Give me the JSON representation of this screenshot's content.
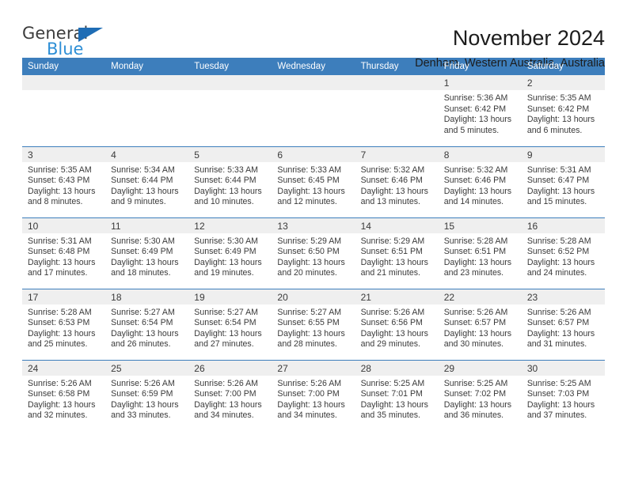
{
  "logo": {
    "primary_text": "General",
    "secondary_text": "Blue",
    "primary_color": "#3c3c3c",
    "secondary_color": "#2e8fd6",
    "triangle_color": "#1f6db5"
  },
  "header": {
    "title": "November 2024",
    "location": "Denham, Western Australia, Australia"
  },
  "theme": {
    "header_bg": "#3d7ebc",
    "header_text": "#ffffff",
    "daynum_band_bg": "#efefef",
    "cell_bg": "#ffffff",
    "row_border": "#3d7ebc",
    "body_text": "#3a3a3a"
  },
  "calendar": {
    "weekday_headers": [
      "Sunday",
      "Monday",
      "Tuesday",
      "Wednesday",
      "Thursday",
      "Friday",
      "Saturday"
    ],
    "weeks": [
      [
        {
          "day": "",
          "empty": true
        },
        {
          "day": "",
          "empty": true
        },
        {
          "day": "",
          "empty": true
        },
        {
          "day": "",
          "empty": true
        },
        {
          "day": "",
          "empty": true
        },
        {
          "day": "1",
          "sunrise": "Sunrise: 5:36 AM",
          "sunset": "Sunset: 6:42 PM",
          "daylight": "Daylight: 13 hours and 5 minutes."
        },
        {
          "day": "2",
          "sunrise": "Sunrise: 5:35 AM",
          "sunset": "Sunset: 6:42 PM",
          "daylight": "Daylight: 13 hours and 6 minutes."
        }
      ],
      [
        {
          "day": "3",
          "sunrise": "Sunrise: 5:35 AM",
          "sunset": "Sunset: 6:43 PM",
          "daylight": "Daylight: 13 hours and 8 minutes."
        },
        {
          "day": "4",
          "sunrise": "Sunrise: 5:34 AM",
          "sunset": "Sunset: 6:44 PM",
          "daylight": "Daylight: 13 hours and 9 minutes."
        },
        {
          "day": "5",
          "sunrise": "Sunrise: 5:33 AM",
          "sunset": "Sunset: 6:44 PM",
          "daylight": "Daylight: 13 hours and 10 minutes."
        },
        {
          "day": "6",
          "sunrise": "Sunrise: 5:33 AM",
          "sunset": "Sunset: 6:45 PM",
          "daylight": "Daylight: 13 hours and 12 minutes."
        },
        {
          "day": "7",
          "sunrise": "Sunrise: 5:32 AM",
          "sunset": "Sunset: 6:46 PM",
          "daylight": "Daylight: 13 hours and 13 minutes."
        },
        {
          "day": "8",
          "sunrise": "Sunrise: 5:32 AM",
          "sunset": "Sunset: 6:46 PM",
          "daylight": "Daylight: 13 hours and 14 minutes."
        },
        {
          "day": "9",
          "sunrise": "Sunrise: 5:31 AM",
          "sunset": "Sunset: 6:47 PM",
          "daylight": "Daylight: 13 hours and 15 minutes."
        }
      ],
      [
        {
          "day": "10",
          "sunrise": "Sunrise: 5:31 AM",
          "sunset": "Sunset: 6:48 PM",
          "daylight": "Daylight: 13 hours and 17 minutes."
        },
        {
          "day": "11",
          "sunrise": "Sunrise: 5:30 AM",
          "sunset": "Sunset: 6:49 PM",
          "daylight": "Daylight: 13 hours and 18 minutes."
        },
        {
          "day": "12",
          "sunrise": "Sunrise: 5:30 AM",
          "sunset": "Sunset: 6:49 PM",
          "daylight": "Daylight: 13 hours and 19 minutes."
        },
        {
          "day": "13",
          "sunrise": "Sunrise: 5:29 AM",
          "sunset": "Sunset: 6:50 PM",
          "daylight": "Daylight: 13 hours and 20 minutes."
        },
        {
          "day": "14",
          "sunrise": "Sunrise: 5:29 AM",
          "sunset": "Sunset: 6:51 PM",
          "daylight": "Daylight: 13 hours and 21 minutes."
        },
        {
          "day": "15",
          "sunrise": "Sunrise: 5:28 AM",
          "sunset": "Sunset: 6:51 PM",
          "daylight": "Daylight: 13 hours and 23 minutes."
        },
        {
          "day": "16",
          "sunrise": "Sunrise: 5:28 AM",
          "sunset": "Sunset: 6:52 PM",
          "daylight": "Daylight: 13 hours and 24 minutes."
        }
      ],
      [
        {
          "day": "17",
          "sunrise": "Sunrise: 5:28 AM",
          "sunset": "Sunset: 6:53 PM",
          "daylight": "Daylight: 13 hours and 25 minutes."
        },
        {
          "day": "18",
          "sunrise": "Sunrise: 5:27 AM",
          "sunset": "Sunset: 6:54 PM",
          "daylight": "Daylight: 13 hours and 26 minutes."
        },
        {
          "day": "19",
          "sunrise": "Sunrise: 5:27 AM",
          "sunset": "Sunset: 6:54 PM",
          "daylight": "Daylight: 13 hours and 27 minutes."
        },
        {
          "day": "20",
          "sunrise": "Sunrise: 5:27 AM",
          "sunset": "Sunset: 6:55 PM",
          "daylight": "Daylight: 13 hours and 28 minutes."
        },
        {
          "day": "21",
          "sunrise": "Sunrise: 5:26 AM",
          "sunset": "Sunset: 6:56 PM",
          "daylight": "Daylight: 13 hours and 29 minutes."
        },
        {
          "day": "22",
          "sunrise": "Sunrise: 5:26 AM",
          "sunset": "Sunset: 6:57 PM",
          "daylight": "Daylight: 13 hours and 30 minutes."
        },
        {
          "day": "23",
          "sunrise": "Sunrise: 5:26 AM",
          "sunset": "Sunset: 6:57 PM",
          "daylight": "Daylight: 13 hours and 31 minutes."
        }
      ],
      [
        {
          "day": "24",
          "sunrise": "Sunrise: 5:26 AM",
          "sunset": "Sunset: 6:58 PM",
          "daylight": "Daylight: 13 hours and 32 minutes."
        },
        {
          "day": "25",
          "sunrise": "Sunrise: 5:26 AM",
          "sunset": "Sunset: 6:59 PM",
          "daylight": "Daylight: 13 hours and 33 minutes."
        },
        {
          "day": "26",
          "sunrise": "Sunrise: 5:26 AM",
          "sunset": "Sunset: 7:00 PM",
          "daylight": "Daylight: 13 hours and 34 minutes."
        },
        {
          "day": "27",
          "sunrise": "Sunrise: 5:26 AM",
          "sunset": "Sunset: 7:00 PM",
          "daylight": "Daylight: 13 hours and 34 minutes."
        },
        {
          "day": "28",
          "sunrise": "Sunrise: 5:25 AM",
          "sunset": "Sunset: 7:01 PM",
          "daylight": "Daylight: 13 hours and 35 minutes."
        },
        {
          "day": "29",
          "sunrise": "Sunrise: 5:25 AM",
          "sunset": "Sunset: 7:02 PM",
          "daylight": "Daylight: 13 hours and 36 minutes."
        },
        {
          "day": "30",
          "sunrise": "Sunrise: 5:25 AM",
          "sunset": "Sunset: 7:03 PM",
          "daylight": "Daylight: 13 hours and 37 minutes."
        }
      ]
    ]
  }
}
